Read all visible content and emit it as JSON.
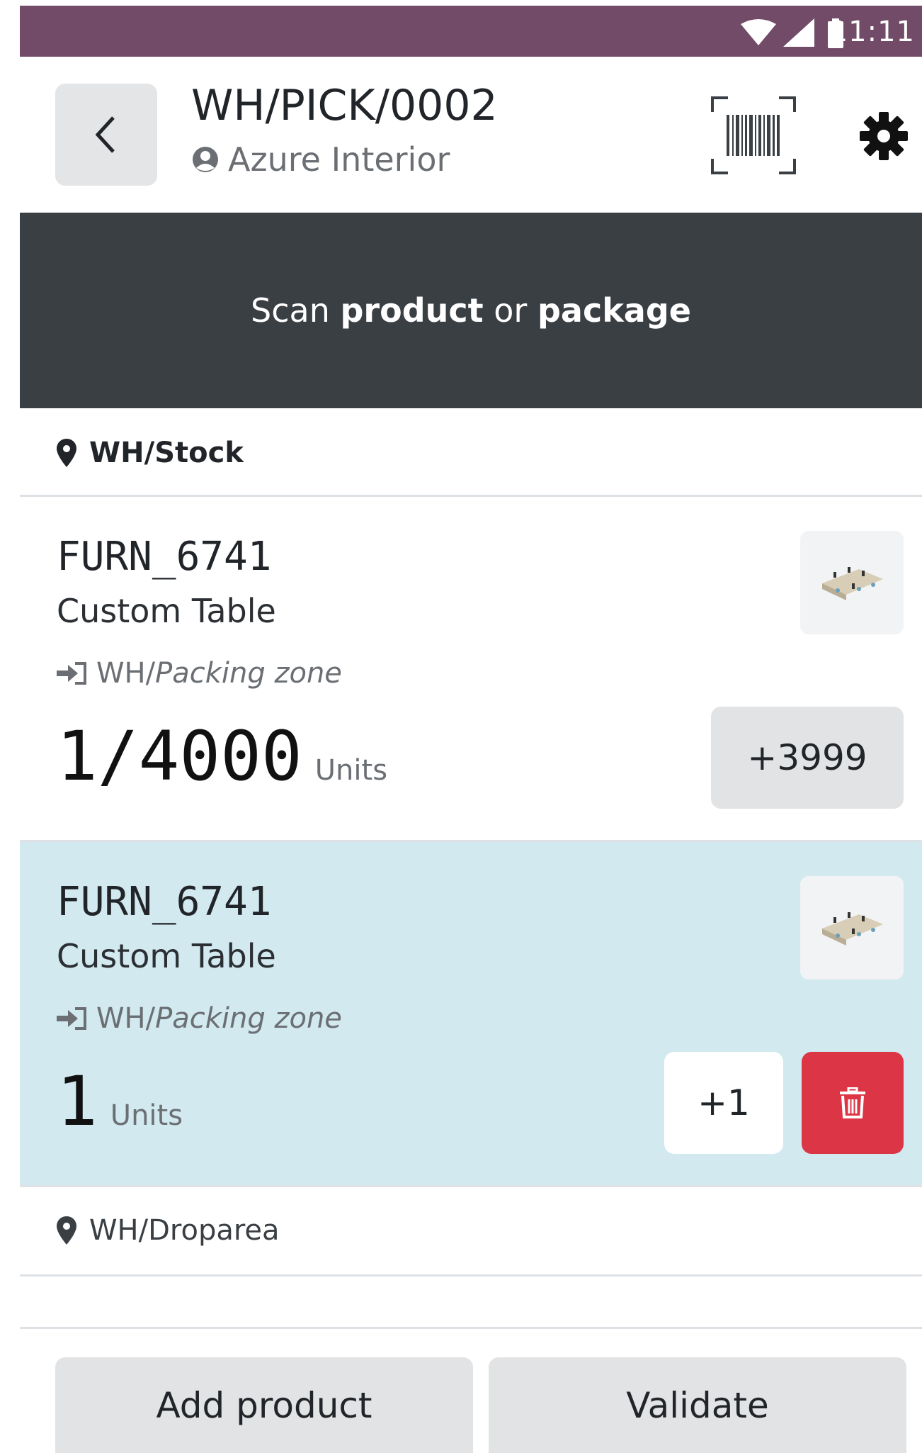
{
  "status_bar": {
    "time": "11:11"
  },
  "header": {
    "title": "WH/PICK/0002",
    "partner": "Azure Interior"
  },
  "scan_banner": {
    "prefix": "Scan ",
    "product": "product",
    "middle": " or ",
    "package": "package"
  },
  "locations": [
    {
      "name": "WH/Stock"
    },
    {
      "name": "WH/Droparea"
    }
  ],
  "lines": [
    {
      "code": "FURN_6741",
      "name": "Custom Table",
      "dest_prefix": "WH/",
      "dest_zone": "Packing zone",
      "qty": "1/4000",
      "unit": "Units",
      "action": "+3999"
    },
    {
      "code": "FURN_6741",
      "name": "Custom Table",
      "dest_prefix": "WH/",
      "dest_zone": "Packing zone",
      "qty": "1",
      "unit": "Units",
      "action": "+1"
    }
  ],
  "footer": {
    "add_product": "Add product",
    "validate": "Validate"
  },
  "colors": {
    "brand": "#714b67",
    "banner": "#3a3f44",
    "selected_row": "#d1e9ef",
    "danger": "#dc3545"
  }
}
